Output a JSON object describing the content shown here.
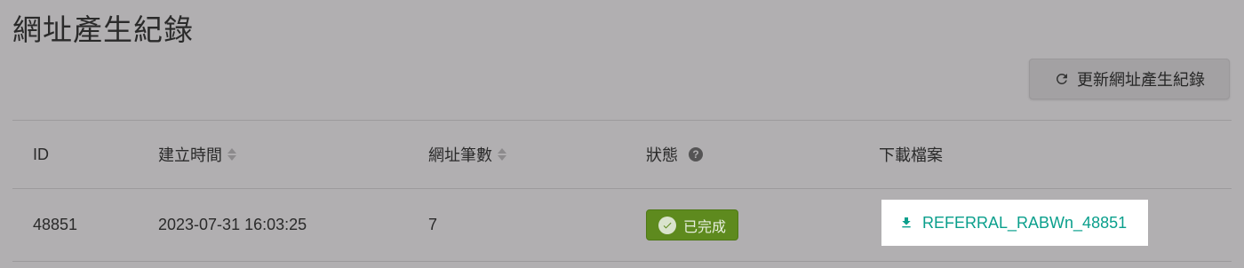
{
  "page": {
    "title": "網址產生紀錄"
  },
  "toolbar": {
    "refresh_label": "更新網址產生紀錄",
    "refresh_icon": "refresh-icon"
  },
  "table": {
    "columns": [
      {
        "label": "ID",
        "sortable": false
      },
      {
        "label": "建立時間",
        "sortable": true
      },
      {
        "label": "網址筆數",
        "sortable": true
      },
      {
        "label": "狀態",
        "help": true
      },
      {
        "label": "下載檔案",
        "sortable": false
      }
    ],
    "rows": [
      {
        "id": "48851",
        "created_at": "2023-07-31 16:03:25",
        "url_count": "7",
        "status": "已完成",
        "file": "REFERRAL_RABWn_48851"
      }
    ]
  },
  "colors": {
    "status_success": "#5e8a1e",
    "link": "#0a9f8c",
    "overlay_bg": "#b1afb1"
  }
}
